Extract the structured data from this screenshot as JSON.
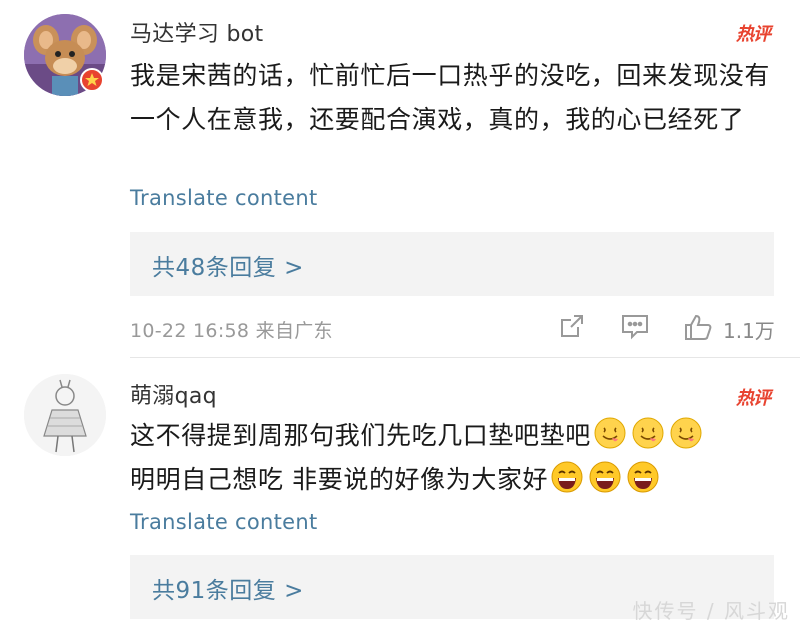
{
  "comments": [
    {
      "username": "马达学习 bot",
      "hot_badge": "热评",
      "text": "我是宋茜的话，忙前忙后一口热乎的没吃，回来发现没有一个人在意我，还要配合演戏，真的，我的心已经死了",
      "translate_label": "Translate content",
      "replies_label": "共48条回复 >",
      "timestamp": "10-22 16:58",
      "location": "来自广东",
      "likes": "1.1万",
      "icons": [
        "share-icon",
        "comment-icon",
        "like-icon"
      ]
    },
    {
      "username": "萌溺qaq",
      "hot_badge": "热评",
      "text_line1": "这不得提到周那句我们先吃几口垫吧垫吧",
      "text_line2": "明明自己想吃 非要说的好像为大家好",
      "translate_label": "Translate content",
      "replies_label": "共91条回复 >"
    }
  ],
  "watermark": "快传号 / 风斗观",
  "colors": {
    "link": "#4a7c9e",
    "hot": "#e8432f",
    "meta": "#999999",
    "reply_bg": "#f3f3f3"
  }
}
